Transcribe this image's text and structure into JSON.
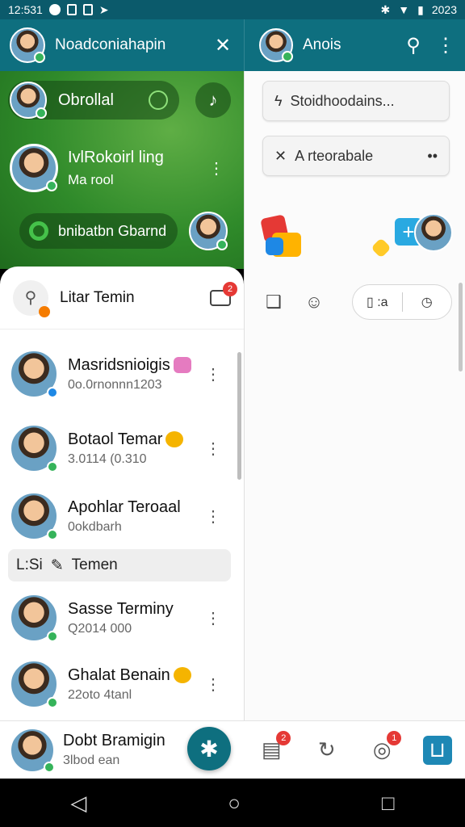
{
  "status_bar": {
    "time": "12:531",
    "right_time": "2023"
  },
  "left_header": {
    "title": "Noadconiahapin",
    "close_icon": "close-icon"
  },
  "right_header": {
    "title": "Anois",
    "search_icon": "search-icon",
    "more_icon": "more-vert-icon"
  },
  "green_area": {
    "pill_top": "Obrollal",
    "profile_name": "IvlRokoirl ling",
    "profile_sub": "Ma rool",
    "pill_bottom": "bnibatbn Gbarnd"
  },
  "sheet": {
    "title": "Litar Temin",
    "badge": "2"
  },
  "contacts": [
    {
      "name": "Masridsnioigis",
      "sub": "0o.0rnonnn1203"
    },
    {
      "name": "Botaol Temar",
      "sub": "3.0114 (0.310"
    },
    {
      "name": "Apohlar Teroaal",
      "sub": "0okdbarh"
    }
  ],
  "section": {
    "label": "Temen",
    "prefix": "L:Si"
  },
  "contacts2": [
    {
      "name": "Sasse Terminy",
      "sub": "Q2014 000"
    },
    {
      "name": "Ghalat Benain",
      "sub": "22oto 4tanl"
    }
  ],
  "footer_user": {
    "name": "Dobt Bramigin",
    "sub": "3lbod ean"
  },
  "right_chips": [
    {
      "label": "Stoidhoodains...",
      "icon": "bolt-icon"
    },
    {
      "label": "A rteorabale",
      "icon": "close-icon"
    }
  ],
  "segment": {
    "left": ":a"
  },
  "right_footer_badges": {
    "notes": "2",
    "camera": "1"
  }
}
